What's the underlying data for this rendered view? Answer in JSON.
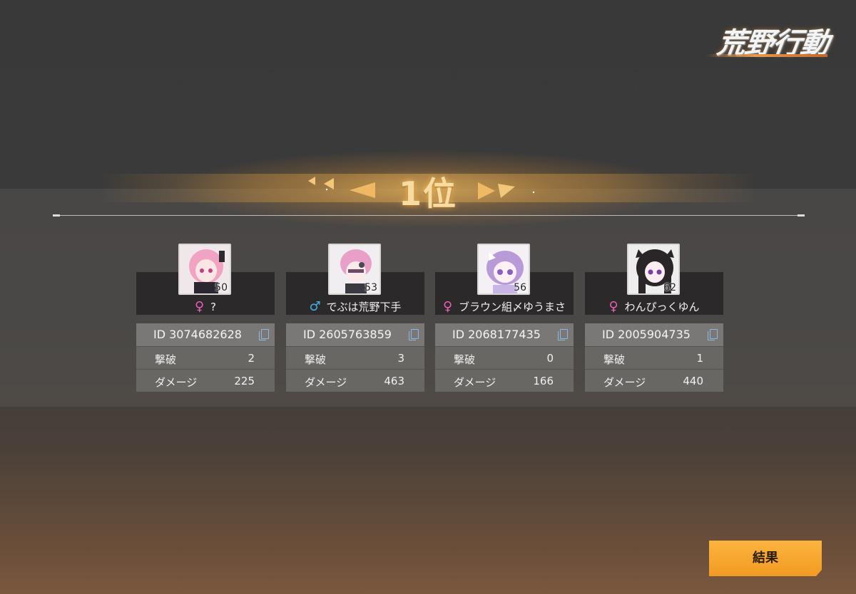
{
  "logo": {
    "text": "荒野行動"
  },
  "rank": {
    "text": "1位"
  },
  "players": [
    {
      "level": "50",
      "gender": "♀",
      "name": "?",
      "id": "ID 3074682628",
      "kills_label": "撃破",
      "kills": "2",
      "damage_label": "ダメージ",
      "damage": "225"
    },
    {
      "level": "53",
      "gender": "♂",
      "name": "でぶは荒野下手",
      "id": "ID 2605763859",
      "kills_label": "撃破",
      "kills": "3",
      "damage_label": "ダメージ",
      "damage": "463"
    },
    {
      "level": "56",
      "gender": "♀",
      "name": "ブラウン組〆ゆうまさ",
      "id": "ID 2068177435",
      "kills_label": "撃破",
      "kills": "0",
      "damage_label": "ダメージ",
      "damage": "166"
    },
    {
      "level": "62",
      "gender": "♀",
      "name": "わんぴっくゆん",
      "id": "ID 2005904735",
      "kills_label": "撃破",
      "kills": "1",
      "damage_label": "ダメージ",
      "damage": "440"
    }
  ],
  "result_button": {
    "label": "結果"
  },
  "colors": {
    "female": "#ea5fb8",
    "male": "#3fb0ea",
    "accent": "#f29b22",
    "rank_gold": "#f6dca0"
  },
  "icons": [
    "copy-icon",
    "female-icon",
    "male-icon"
  ]
}
